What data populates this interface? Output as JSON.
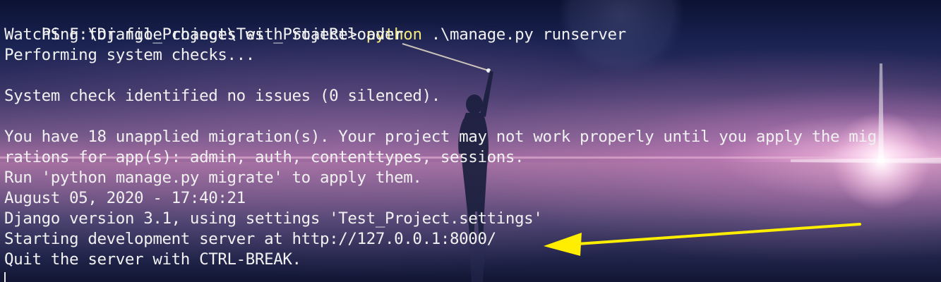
{
  "terminal": {
    "prompt": "PS F:\\Django_Project\\Test_Project> ",
    "command_program": "python",
    "command_args": " .\\manage.py runserver",
    "output_lines": [
      "Watching for file changes with StatReloader",
      "Performing system checks...",
      "",
      "System check identified no issues (0 silenced).",
      "",
      "You have 18 unapplied migration(s). Your project may not work properly until you apply the mig",
      "rations for app(s): admin, auth, contenttypes, sessions.",
      "Run 'python manage.py migrate' to apply them.",
      "August 05, 2020 - 17:40:21",
      "Django version 3.1, using settings 'Test_Project.settings'",
      "Starting development server at http://127.0.0.1:8000/",
      "Quit the server with CTRL-BREAK."
    ]
  },
  "colors": {
    "text": "#f1f1f1",
    "command_highlight": "#f2e97a",
    "annotation_arrow": "#ffee00"
  },
  "annotation": {
    "type": "arrow",
    "points_to": "Starting development server at http://127.0.0.1:8000/"
  }
}
